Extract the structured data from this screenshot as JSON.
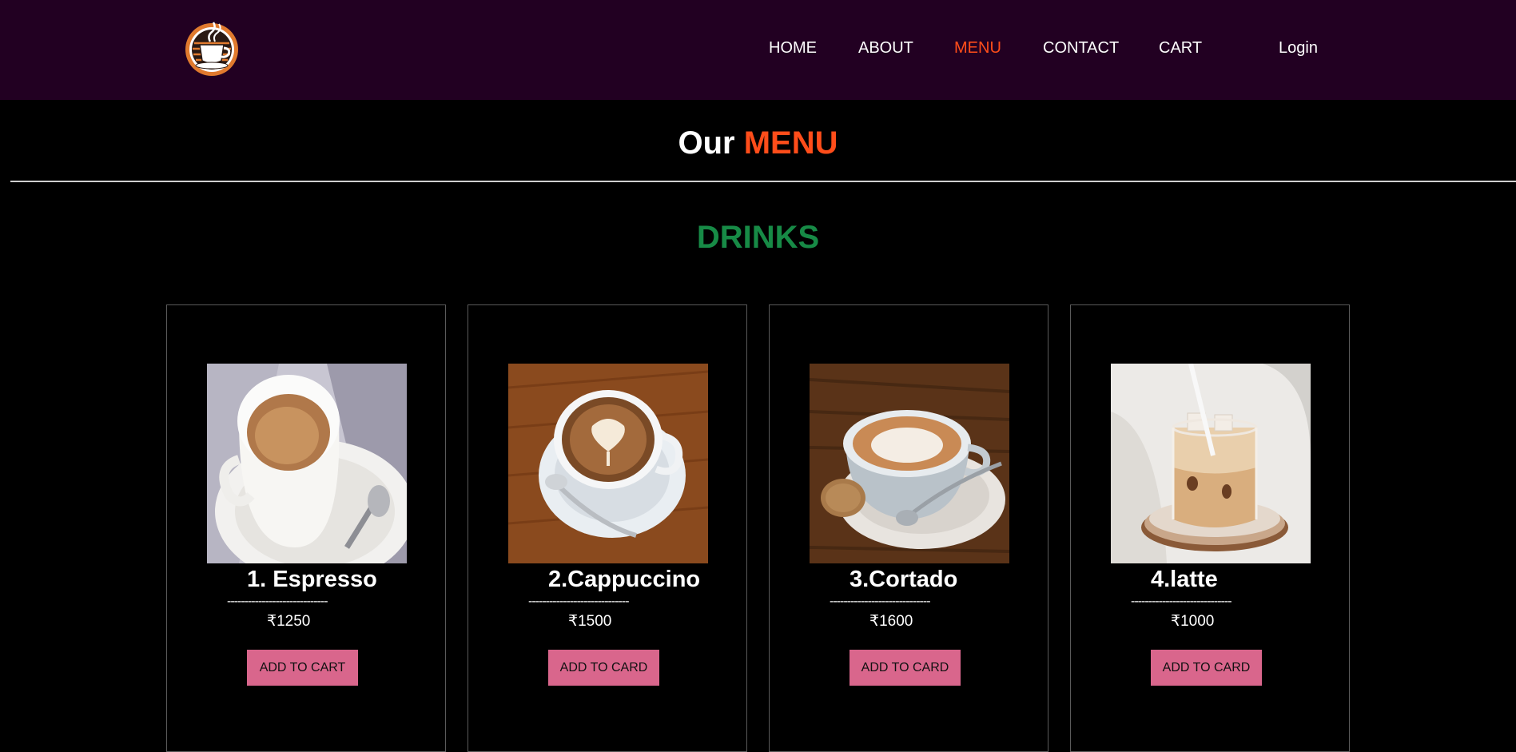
{
  "nav": {
    "logo_alt": "coffee cup logo",
    "links": [
      {
        "label": "HOME",
        "active": false
      },
      {
        "label": "ABOUT",
        "active": false
      },
      {
        "label": "MENU",
        "active": true
      },
      {
        "label": "CONTACT",
        "active": false
      },
      {
        "label": "CART",
        "active": false
      }
    ],
    "login_label": "Login",
    "active_color": "#ff4d1a"
  },
  "page_title": {
    "prefix": "Our",
    "accent": "MENU"
  },
  "section": {
    "heading": "DRINKS",
    "heading_color": "#178a46"
  },
  "products": [
    {
      "name": "1. Espresso",
      "divider": "-----------------------------",
      "price": "₹1250",
      "button_label": "ADD TO CART",
      "image": "espresso-photo"
    },
    {
      "name": "2.Cappuccino",
      "divider": "-----------------------------",
      "price": "₹1500",
      "button_label": "ADD TO CARD",
      "image": "cappuccino-photo"
    },
    {
      "name": "3.Cortado",
      "divider": "-----------------------------",
      "price": "₹1600",
      "button_label": "ADD TO CARD",
      "image": "cortado-photo"
    },
    {
      "name": "4.latte",
      "divider": "-----------------------------",
      "price": "₹1000",
      "button_label": "ADD TO CARD",
      "image": "latte-photo"
    }
  ],
  "colors": {
    "navbar_bg": "#220022",
    "page_bg": "#000000",
    "button_bg": "#d9668c"
  }
}
